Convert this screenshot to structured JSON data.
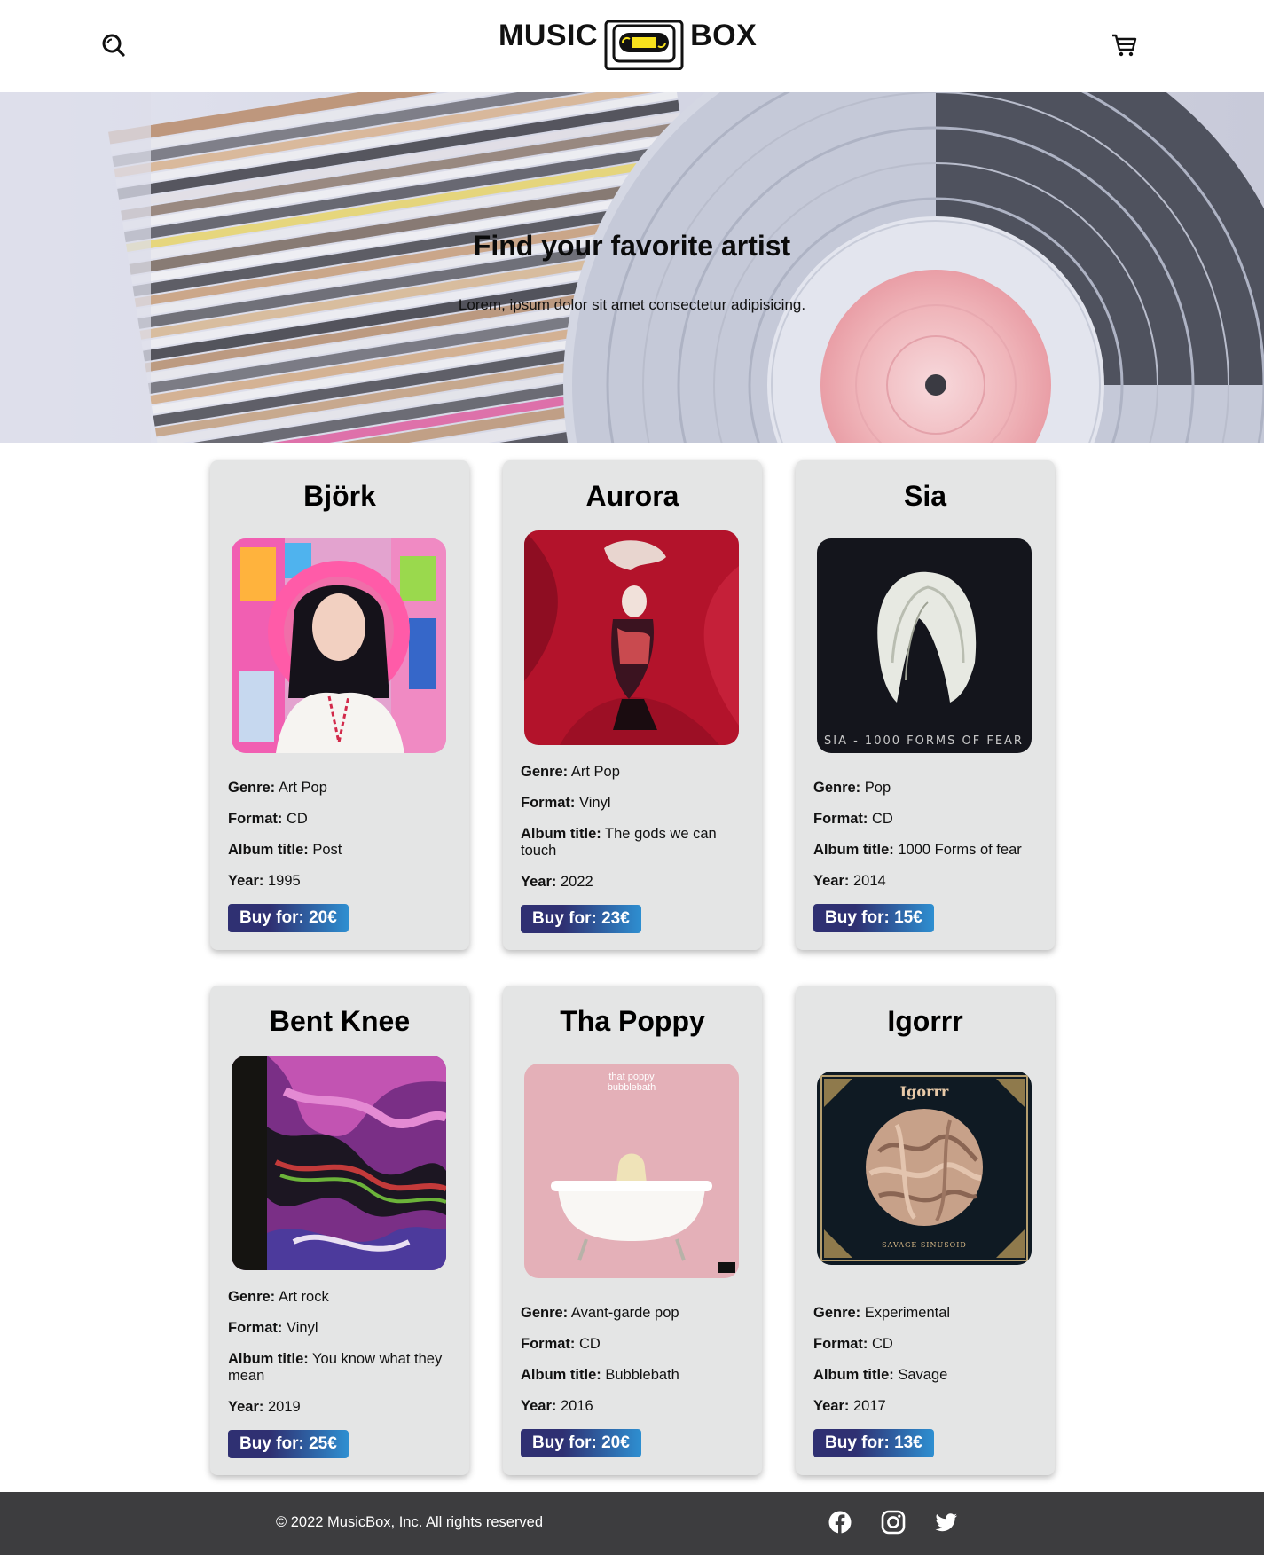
{
  "header": {
    "logo_left": "MUSIC",
    "logo_right": "BOX",
    "search_icon": "search-icon",
    "cart_icon": "cart-icon"
  },
  "hero": {
    "title": "Find your favorite artist",
    "subtitle": "Lorem, ipsum dolor sit amet consectetur adipisicing."
  },
  "labels": {
    "genre": "Genre:",
    "format": "Format:",
    "album_title": "Album title:",
    "year": "Year:"
  },
  "cards": [
    {
      "artist": "Björk",
      "genre": "Art Pop",
      "format": "CD",
      "album": "Post",
      "year": "1995",
      "buy": "Buy for: 20€"
    },
    {
      "artist": "Aurora",
      "genre": "Art Pop",
      "format": "Vinyl",
      "album": "The gods we can touch",
      "year": "2022",
      "buy": "Buy for: 23€"
    },
    {
      "artist": "Sia",
      "genre": "Pop",
      "format": "CD",
      "album": "1000 Forms of fear",
      "year": "2014",
      "buy": "Buy for: 15€",
      "cover_text": "SIA - 1000 FORMS OF FEAR"
    },
    {
      "artist": "Bent Knee",
      "genre": "Art rock",
      "format": "Vinyl",
      "album": "You know what they mean",
      "year": "2019",
      "buy": "Buy for: 25€"
    },
    {
      "artist": "Tha Poppy",
      "genre": "Avant-garde pop",
      "format": "CD",
      "album": "Bubblebath",
      "year": "2016",
      "buy": "Buy for: 20€",
      "cover_text_1": "that poppy",
      "cover_text_2": "bubblebath"
    },
    {
      "artist": "Igorrr",
      "genre": "Experimental",
      "format": "CD",
      "album": "Savage",
      "year": "2017",
      "buy": "Buy for: 13€",
      "cover_text_1": "Igorrr",
      "cover_text_2": "SAVAGE SINUSOID"
    }
  ],
  "footer": {
    "copyright": "© 2022 MusicBox, Inc. All rights reserved",
    "social": [
      "facebook-icon",
      "instagram-icon",
      "twitter-icon"
    ]
  },
  "colors": {
    "card_bg": "#e4e5e5",
    "button_start": "#2f3072",
    "button_end": "#2e8fd1",
    "footer_bg": "#3d3d3f"
  }
}
